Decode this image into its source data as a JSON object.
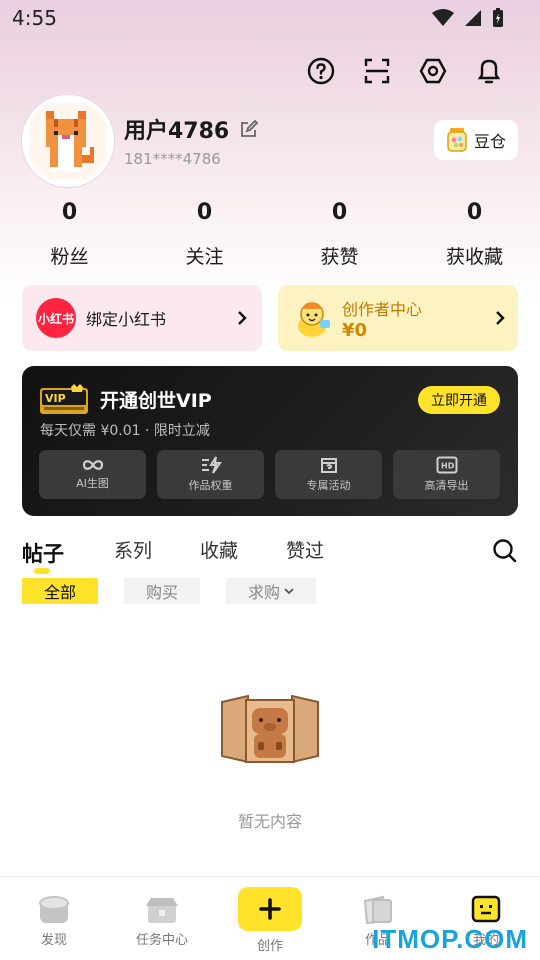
{
  "status": {
    "time": "4:55"
  },
  "profile": {
    "username": "用户4786",
    "phone": "181****4786",
    "doucang_label": "豆仓"
  },
  "stats": [
    {
      "count": "0",
      "label": "粉丝"
    },
    {
      "count": "0",
      "label": "关注"
    },
    {
      "count": "0",
      "label": "获赞"
    },
    {
      "count": "0",
      "label": "获收藏"
    }
  ],
  "cards": {
    "xhs_logo": "小红书",
    "xhs_label": "绑定小红书",
    "creator_label": "创作者中心",
    "creator_amount": "¥0"
  },
  "vip": {
    "badge": "VIP",
    "title": "开通创世VIP",
    "subtitle": "每天仅需 ¥0.01 · 限时立减",
    "cta": "立即开通",
    "features": [
      {
        "label": "AI生图",
        "icon": "infinity-icon"
      },
      {
        "label": "作品权重",
        "icon": "boost-icon"
      },
      {
        "label": "专属活动",
        "icon": "gift-icon"
      },
      {
        "label": "高清导出",
        "icon": "hd-icon"
      }
    ]
  },
  "tabs": [
    "帖子",
    "系列",
    "收藏",
    "赞过"
  ],
  "filters": [
    "全部",
    "购买",
    "求购"
  ],
  "empty": {
    "text": "暂无内容"
  },
  "nav": [
    {
      "label": "发现",
      "icon": "discover-icon"
    },
    {
      "label": "任务中心",
      "icon": "task-center-icon"
    },
    {
      "label": "创作",
      "icon": "plus-icon"
    },
    {
      "label": "作品",
      "icon": "works-icon"
    },
    {
      "label": "我的",
      "icon": "me-icon"
    }
  ],
  "watermark": "ITMOP.COM",
  "colors": {
    "accent": "#ffe32a",
    "xhs_red": "#ff2442",
    "vip_bg": "#1a1a1a"
  }
}
